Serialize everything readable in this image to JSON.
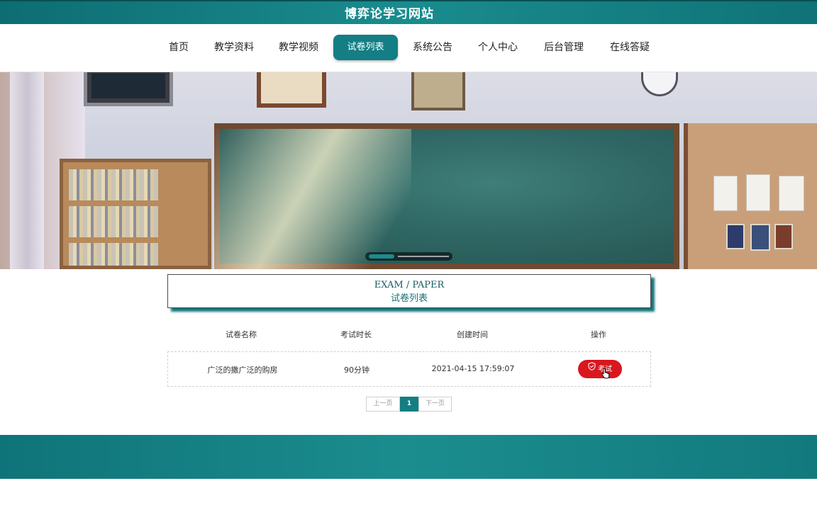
{
  "site": {
    "title": "博弈论学习网站"
  },
  "nav": {
    "items": [
      {
        "label": "首页"
      },
      {
        "label": "教学资料"
      },
      {
        "label": "教学视频"
      },
      {
        "label": "试卷列表",
        "active": true
      },
      {
        "label": "系统公告"
      },
      {
        "label": "个人中心"
      },
      {
        "label": "后台管理"
      },
      {
        "label": "在线答疑"
      }
    ]
  },
  "banner": {
    "carousel_active_index": 0,
    "carousel_count": 2
  },
  "section": {
    "title_en": "EXAM / PAPER",
    "title_cn": "试卷列表"
  },
  "table": {
    "headers": [
      "试卷名称",
      "考试时长",
      "创建时间",
      "操作"
    ],
    "rows": [
      {
        "name": "广泛的撒广泛的购房",
        "duration": "90分钟",
        "created": "2021-04-15 17:59:07",
        "action": "考试"
      }
    ]
  },
  "pagination": {
    "prev": "上一页",
    "current": "1",
    "next": "下一页"
  },
  "colors": {
    "accent": "#137e84",
    "danger": "#d8171f",
    "footer": "#1b8d8f"
  },
  "icons": {
    "exam_button": "shield-check-icon",
    "pointer": "hand-pointer-icon"
  }
}
